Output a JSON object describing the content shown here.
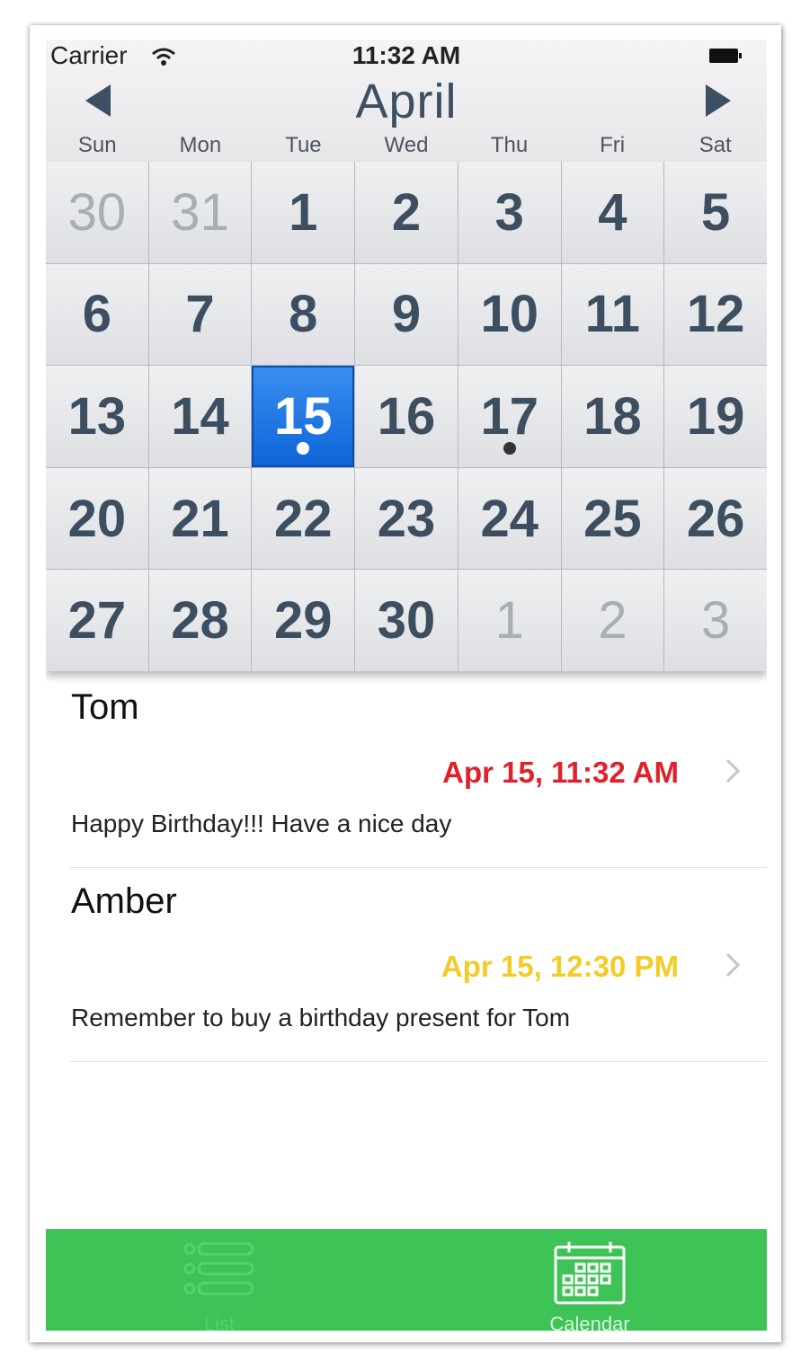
{
  "status_bar": {
    "carrier": "Carrier",
    "time": "11:32 AM",
    "wifi_icon": "wifi-icon",
    "battery_icon": "battery-icon"
  },
  "calendar": {
    "month": "April",
    "prev_icon": "triangle-left-icon",
    "next_icon": "triangle-right-icon",
    "weekdays": [
      "Sun",
      "Mon",
      "Tue",
      "Wed",
      "Thu",
      "Fri",
      "Sat"
    ],
    "days": [
      {
        "label": "30",
        "muted": true
      },
      {
        "label": "31",
        "muted": true
      },
      {
        "label": "1"
      },
      {
        "label": "2"
      },
      {
        "label": "3"
      },
      {
        "label": "4"
      },
      {
        "label": "5"
      },
      {
        "label": "6"
      },
      {
        "label": "7"
      },
      {
        "label": "8"
      },
      {
        "label": "9"
      },
      {
        "label": "10"
      },
      {
        "label": "11"
      },
      {
        "label": "12"
      },
      {
        "label": "13"
      },
      {
        "label": "14"
      },
      {
        "label": "15",
        "selected": true,
        "has_event": true
      },
      {
        "label": "16"
      },
      {
        "label": "17",
        "has_event": true
      },
      {
        "label": "18"
      },
      {
        "label": "19"
      },
      {
        "label": "20"
      },
      {
        "label": "21"
      },
      {
        "label": "22"
      },
      {
        "label": "23"
      },
      {
        "label": "24"
      },
      {
        "label": "25"
      },
      {
        "label": "26"
      },
      {
        "label": "27"
      },
      {
        "label": "28"
      },
      {
        "label": "29"
      },
      {
        "label": "30"
      },
      {
        "label": "1",
        "muted": true
      },
      {
        "label": "2",
        "muted": true
      },
      {
        "label": "3",
        "muted": true
      }
    ],
    "selected_color": "#1a6fe0"
  },
  "events": [
    {
      "name": "Tom",
      "time": "Apr 15, 11:32 AM",
      "time_color": "#e0202a",
      "note": "Happy Birthday!!! Have a nice day"
    },
    {
      "name": "Amber",
      "time": "Apr 15, 12:30 PM",
      "time_color": "#f2cc28",
      "note": "Remember to buy a birthday present for Tom"
    }
  ],
  "tab_bar": {
    "background": "#3dc356",
    "tabs": [
      {
        "label": "List",
        "icon": "list-icon",
        "active": false
      },
      {
        "label": "Calendar",
        "icon": "calendar-icon",
        "active": true
      }
    ]
  }
}
